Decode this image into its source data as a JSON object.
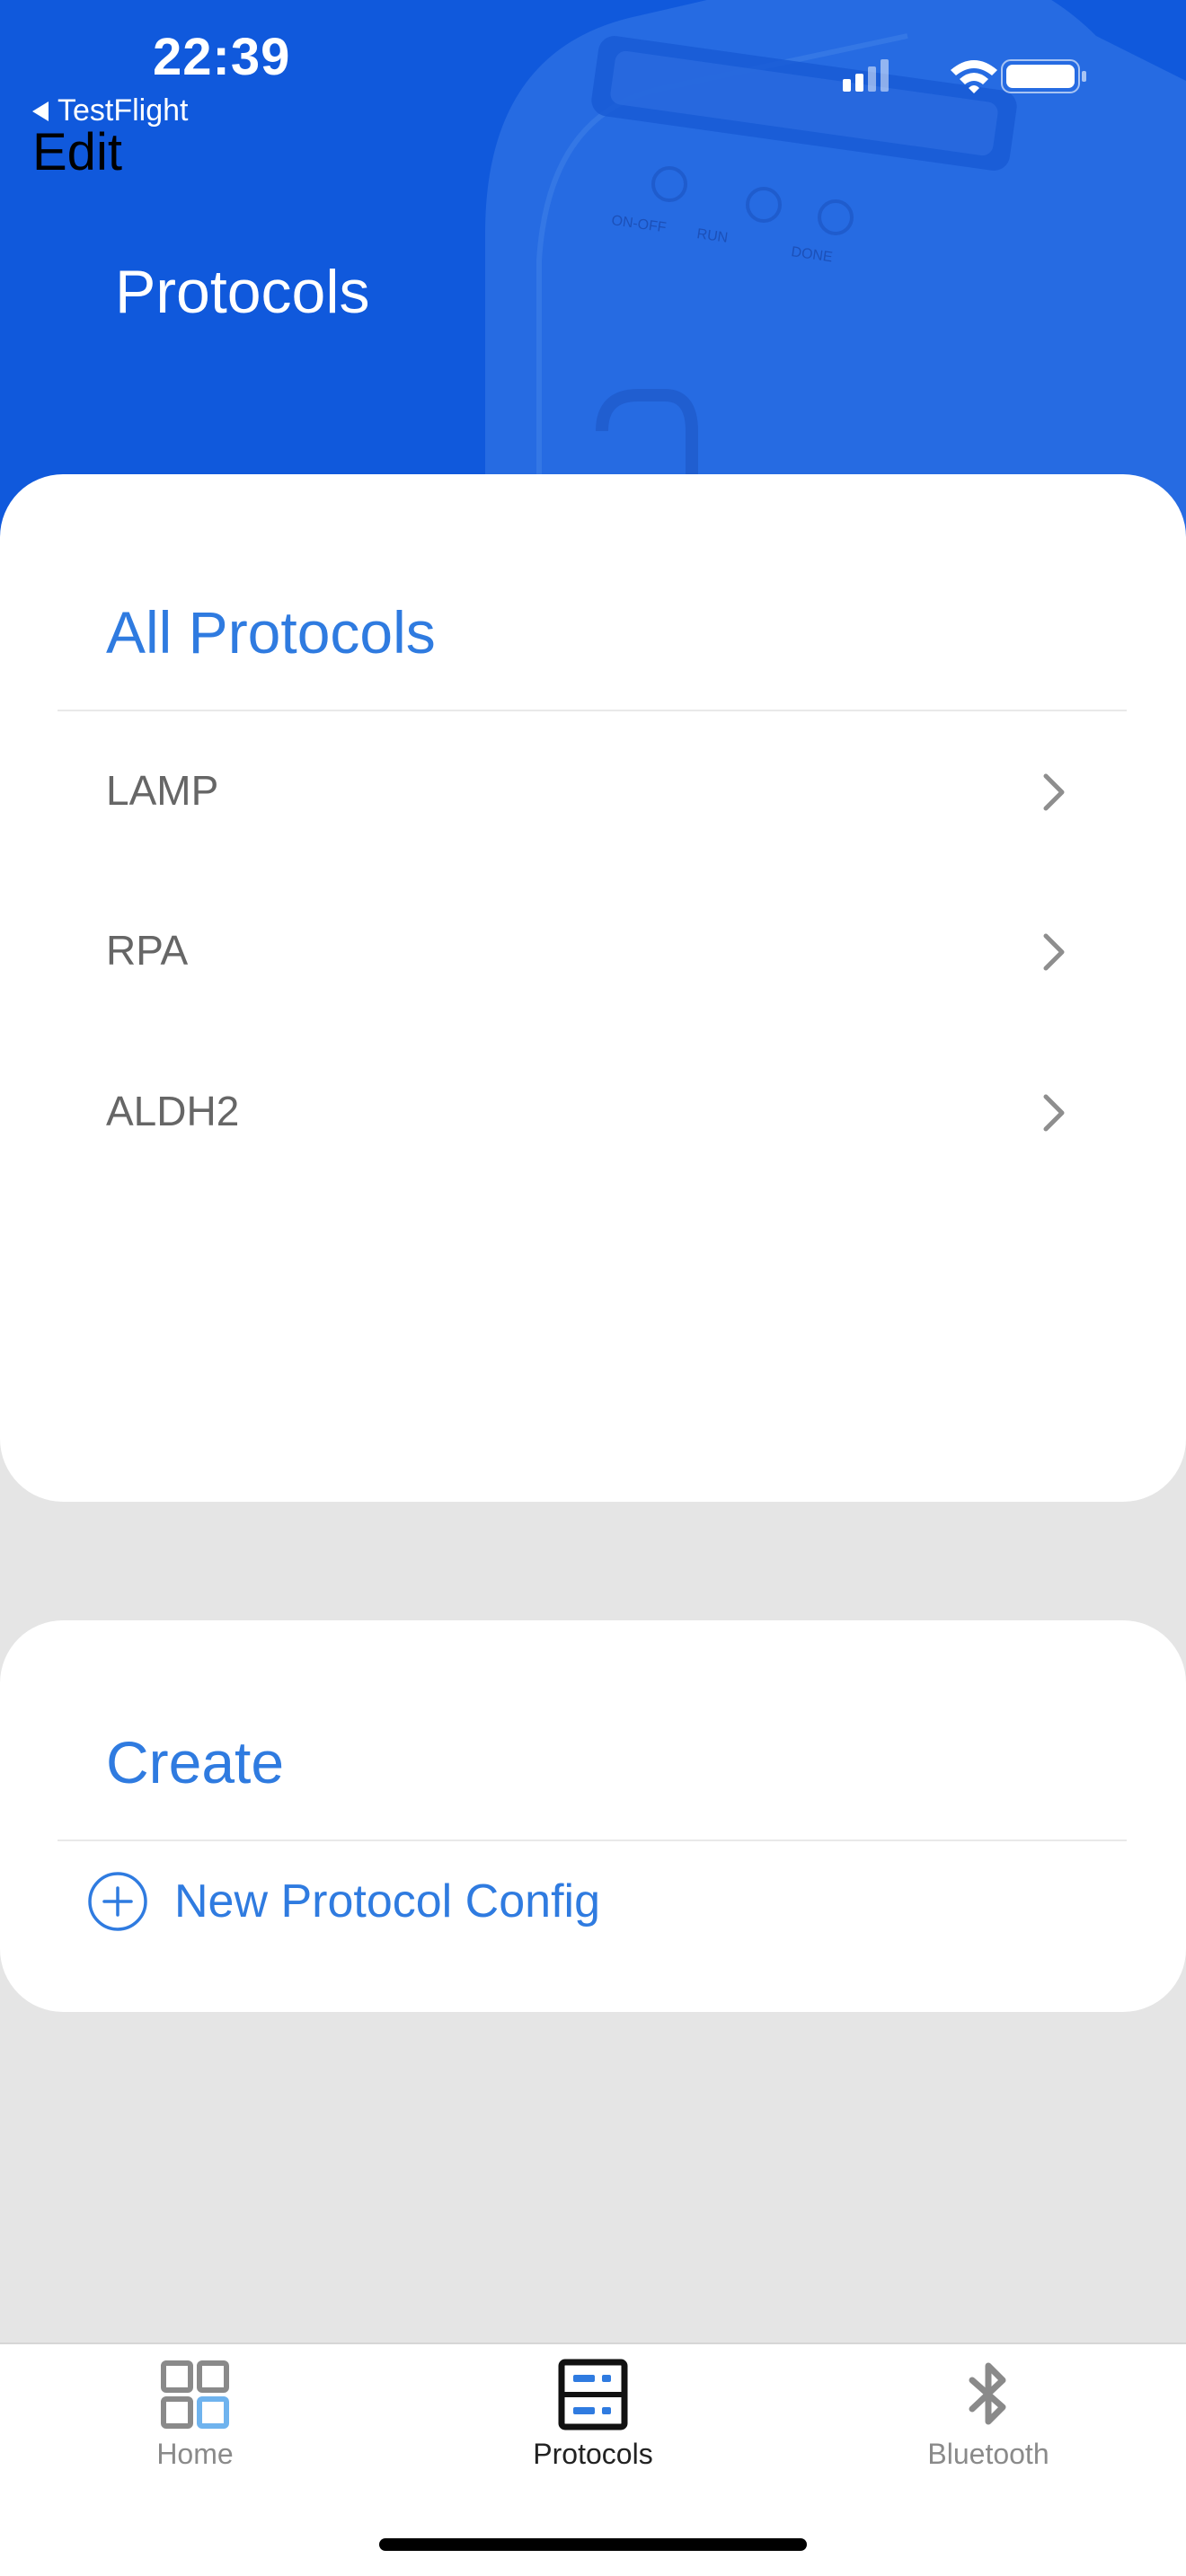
{
  "status_bar": {
    "time": "22:39",
    "back_app": "TestFlight"
  },
  "nav": {
    "edit_label": "Edit",
    "title": "Protocols"
  },
  "protocols_card": {
    "title": "All Protocols",
    "items": [
      {
        "label": "LAMP"
      },
      {
        "label": "RPA"
      },
      {
        "label": "ALDH2"
      }
    ]
  },
  "create_card": {
    "title": "Create",
    "new_config_label": "New Protocol Config"
  },
  "tabbar": {
    "tabs": [
      {
        "label": "Home",
        "icon": "grid-icon",
        "selected": false
      },
      {
        "label": "Protocols",
        "icon": "server-icon",
        "selected": true
      },
      {
        "label": "Bluetooth",
        "icon": "bluetooth-icon",
        "selected": false
      }
    ]
  },
  "device_bg_labels": [
    "ON-OFF",
    "RUN",
    "DONE"
  ],
  "colors": {
    "header_blue": "#1059dc",
    "accent_blue": "#2f7be0",
    "background": "#e5e5e5"
  }
}
